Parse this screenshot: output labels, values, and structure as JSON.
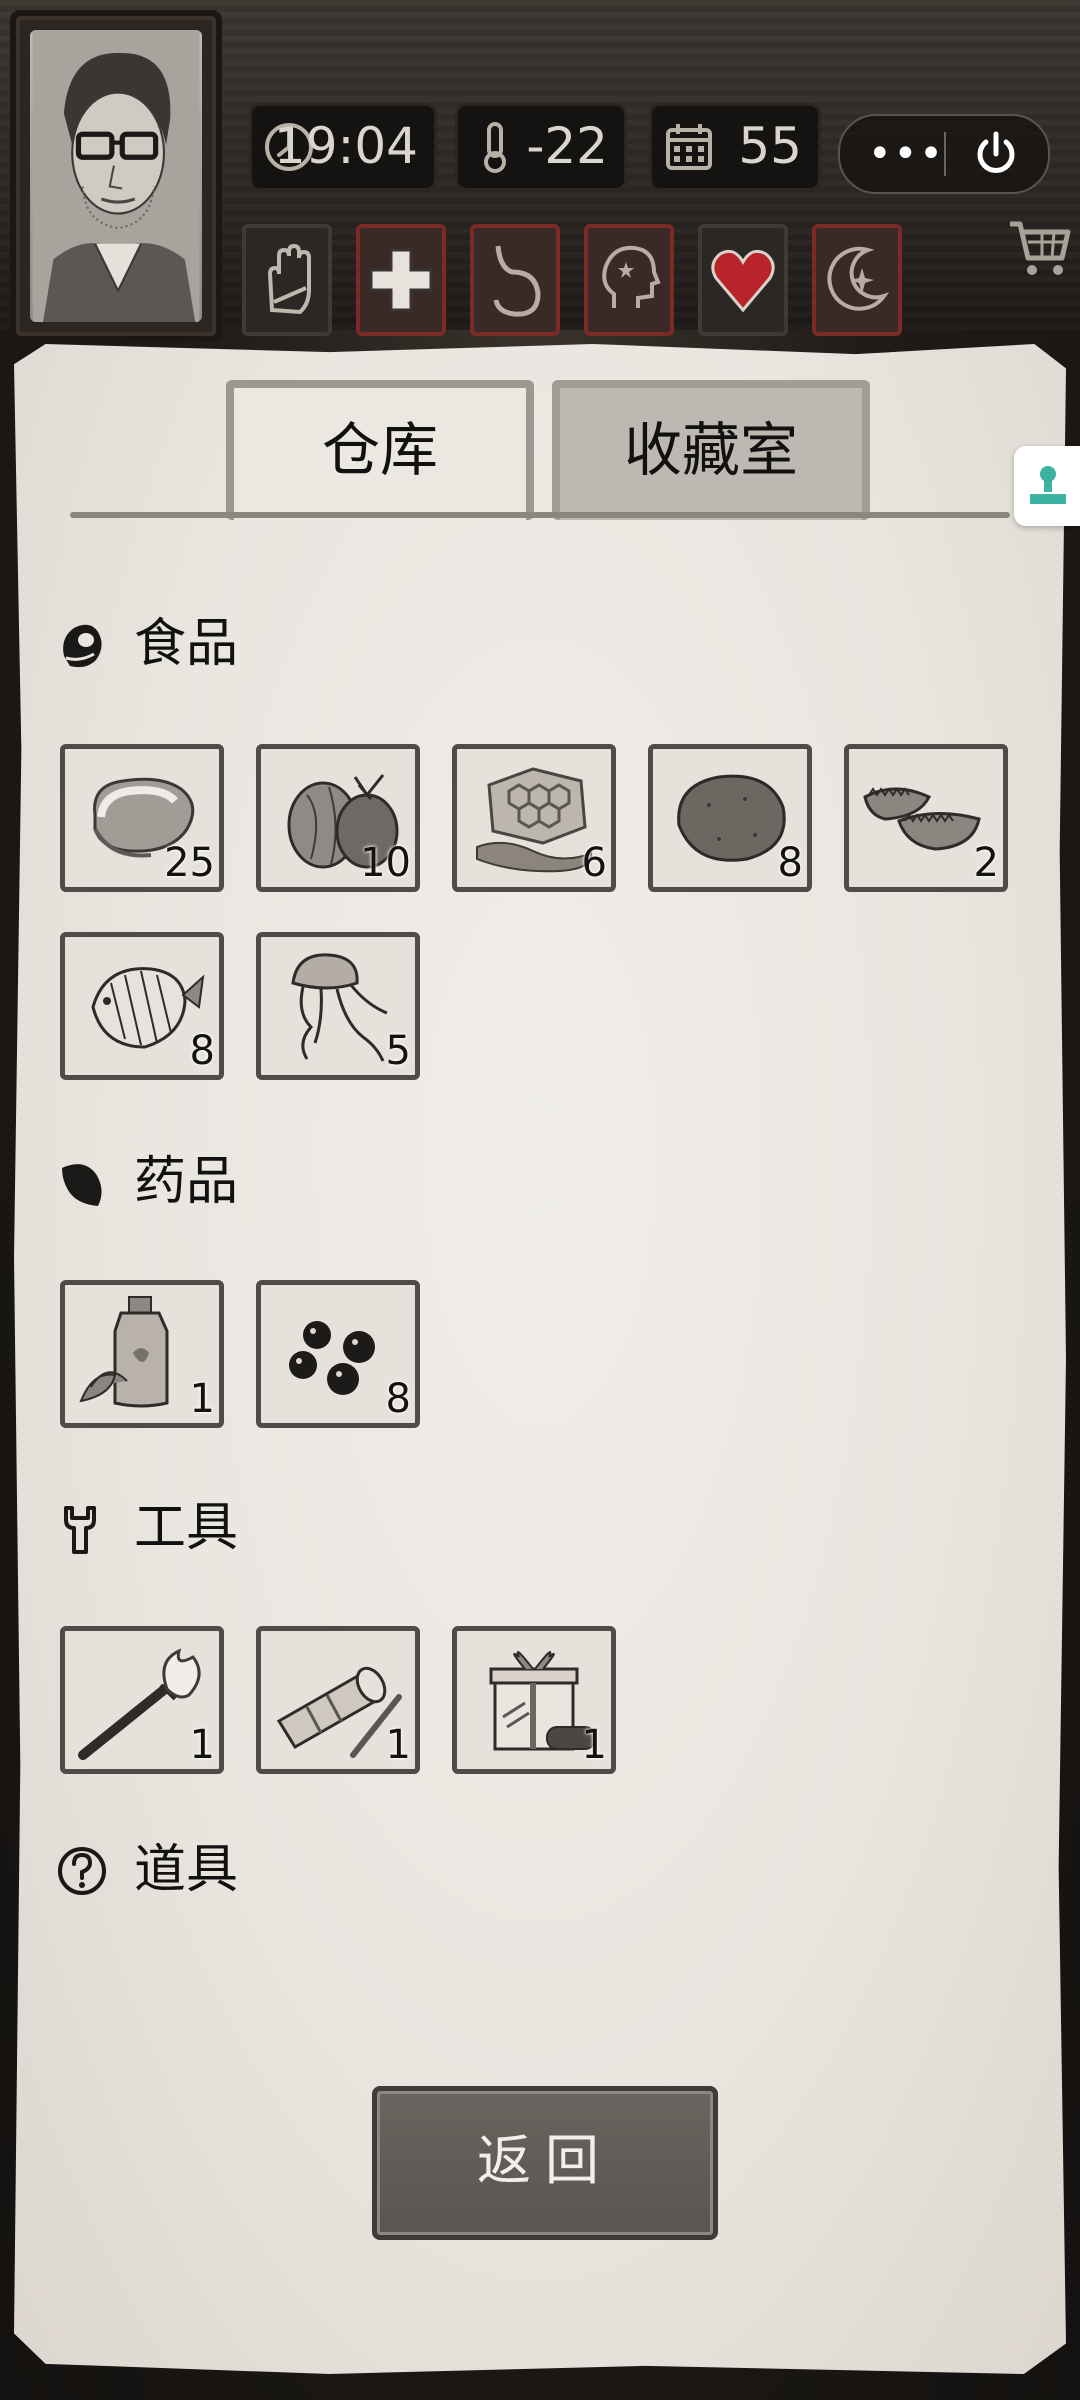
{
  "hud": {
    "time": "19:04",
    "temperature": "-22",
    "day": "55",
    "menu_dots": "•••"
  },
  "status_icons": [
    {
      "name": "hand-icon",
      "state": "normal"
    },
    {
      "name": "medical-cross-icon",
      "state": "alert"
    },
    {
      "name": "stomach-icon",
      "state": "alert"
    },
    {
      "name": "head-dizzy-icon",
      "state": "alert"
    },
    {
      "name": "heart-icon",
      "state": "normal"
    },
    {
      "name": "moon-star-icon",
      "state": "alert"
    }
  ],
  "tabs": {
    "warehouse": "仓库",
    "collection": "收藏室",
    "active": "warehouse"
  },
  "sections": {
    "food": {
      "label": "食品",
      "items": [
        {
          "name": "meat",
          "count": "25"
        },
        {
          "name": "coconut",
          "count": "10"
        },
        {
          "name": "honeycomb",
          "count": "6"
        },
        {
          "name": "potato",
          "count": "8"
        },
        {
          "name": "sea-cucumber",
          "count": "2"
        },
        {
          "name": "fish",
          "count": "8"
        },
        {
          "name": "jellyfish",
          "count": "5"
        }
      ]
    },
    "medicine": {
      "label": "药品",
      "items": [
        {
          "name": "herbal-bottle",
          "count": "1"
        },
        {
          "name": "berries",
          "count": "8"
        }
      ]
    },
    "tools": {
      "label": "工具",
      "items": [
        {
          "name": "torch",
          "count": "1"
        },
        {
          "name": "flashlight",
          "count": "1"
        },
        {
          "name": "gift-box",
          "count": "1"
        }
      ]
    },
    "props": {
      "label": "道具",
      "items": []
    }
  },
  "back_button": "返回",
  "colors": {
    "paper": "#e9e5df",
    "slot_border": "#4f4b47",
    "alert_border": "#7c2a25",
    "heart": "#b8242a",
    "side_button_accent": "#3bb3a0"
  }
}
